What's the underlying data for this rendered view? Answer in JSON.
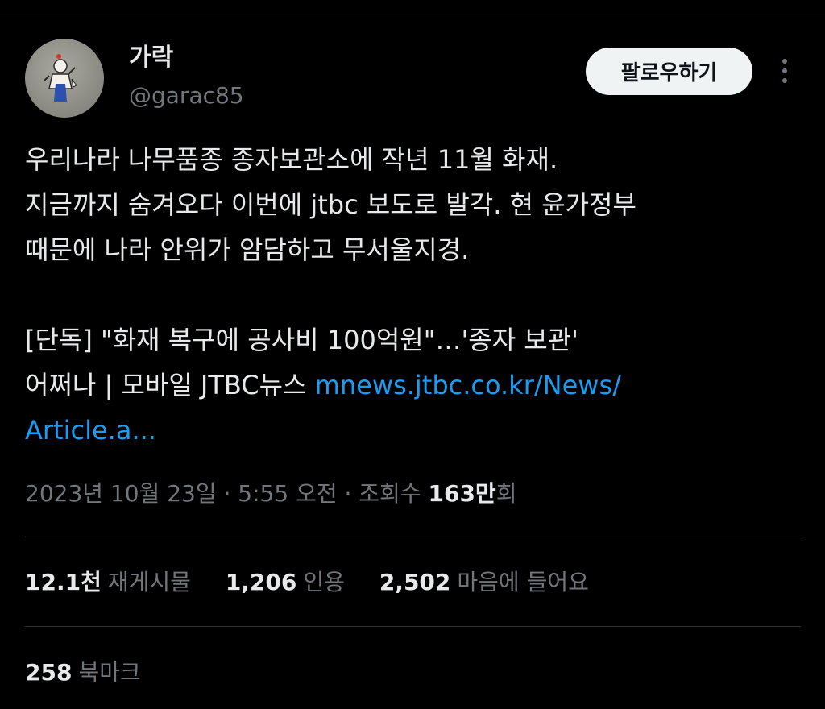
{
  "author": {
    "display_name": "가락",
    "handle": "@garac85",
    "avatar_icon": "avatar-illustration"
  },
  "actions": {
    "follow_label": "팔로우하기",
    "more_icon": "more-vertical-icon"
  },
  "tweet": {
    "lines": [
      "우리나라 나무품종 종자보관소에 작년 11월 화재.",
      "지금까지 숨겨오다 이번에 jtbc 보도로 발각. 현 윤가정부",
      "때문에 나라 안위가 암담하고 무서울지경.",
      "[단독] \"화재 복구에 공사비 100억원\"…'종자 보관'",
      "어쩌나 | 모바일 JTBC뉴스 "
    ],
    "link_part1": "mnews.jtbc.co.kr/News/",
    "link_part2": "Article.a..."
  },
  "meta": {
    "timestamp": "2023년 10월 23일 · 5:55 오전 · 조회수 ",
    "views_count": "163만",
    "views_suffix": "회"
  },
  "stats": {
    "reposts_count": "12.1천",
    "reposts_label": "재게시물",
    "quotes_count": "1,206",
    "quotes_label": "인용",
    "likes_count": "2,502",
    "likes_label": "마음에 들어요",
    "bookmarks_count": "258",
    "bookmarks_label": "북마크"
  },
  "colors": {
    "background": "#000000",
    "text": "#e7e9ea",
    "secondary": "#71767b",
    "link": "#1d9bf0",
    "divider": "#2f3336"
  }
}
